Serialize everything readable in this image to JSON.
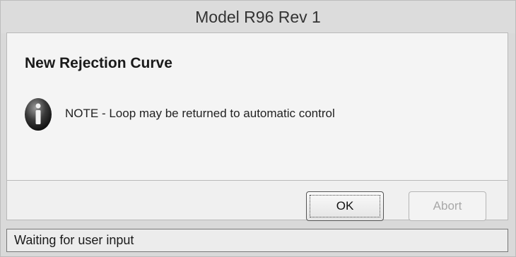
{
  "window": {
    "title": "Model R96 Rev 1"
  },
  "dialog": {
    "heading": "New Rejection Curve",
    "icon": "info-icon",
    "message": "NOTE - Loop may be returned to automatic control"
  },
  "buttons": {
    "ok_label": "OK",
    "abort_label": "Abort",
    "abort_enabled": false
  },
  "status": {
    "text": "Waiting for user input"
  }
}
